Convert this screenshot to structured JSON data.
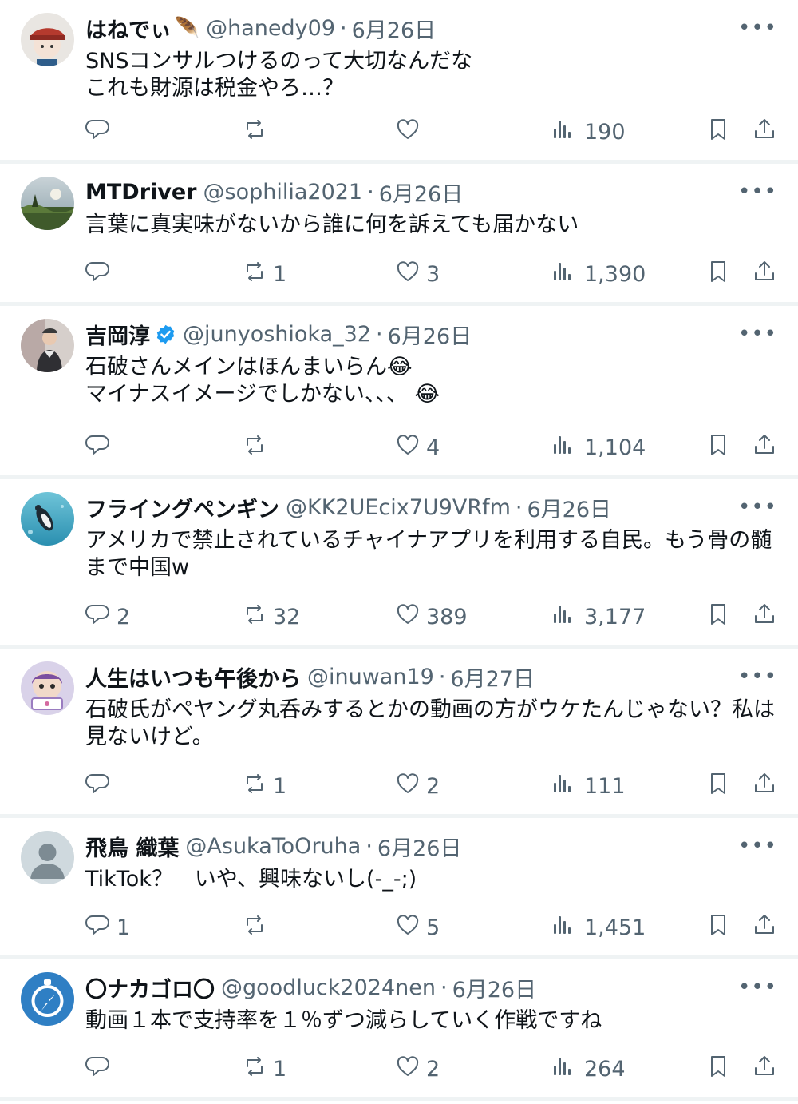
{
  "posts": [
    {
      "name": "はねでぃ",
      "name_emoji": "🪶",
      "handle": "@hanedy09",
      "date": "6月26日",
      "lines": [
        "SNSコンサルつけるのって大切なんだな",
        "これも財源は税金やろ…？"
      ],
      "replies": "",
      "reposts": "",
      "likes": "",
      "views": "190",
      "avatar_icon": "avatar-red-cap-icon"
    },
    {
      "name": "MTDriver",
      "handle": "@sophilia2021",
      "date": "6月26日",
      "lines": [
        "言葉に真実味がないから誰に何を訴えても届かない"
      ],
      "replies": "",
      "reposts": "1",
      "likes": "3",
      "views": "1,390",
      "avatar_icon": "avatar-landscape-icon"
    },
    {
      "name": "吉岡淳",
      "verified": true,
      "handle": "@junyoshioka_32",
      "date": "6月26日",
      "lines": [
        "石破さんメインはほんまいらん😂",
        "マイナスイメージでしかない、、、 😂"
      ],
      "replies": "",
      "reposts": "",
      "likes": "4",
      "views": "1,104",
      "avatar_icon": "avatar-person-photo-icon"
    },
    {
      "name": "フライングペンギン",
      "handle": "@KK2UEcix7U9VRfm",
      "date": "6月26日",
      "lines": [
        "アメリカで禁止されているチャイナアプリを利用する自民。もう骨の髄まで中国w"
      ],
      "replies": "2",
      "reposts": "32",
      "likes": "389",
      "views": "3,177",
      "avatar_icon": "avatar-penguin-icon"
    },
    {
      "name": "人生はいつも午後から",
      "handle": "@inuwan19",
      "date": "6月27日",
      "lines": [
        "石破氏がペヤング丸呑みするとかの動画の方がウケたんじゃない？私は見ないけど。"
      ],
      "replies": "",
      "reposts": "1",
      "likes": "2",
      "views": "111",
      "avatar_icon": "avatar-character-icon"
    },
    {
      "name": "飛鳥 織葉",
      "handle": "@AsukaToOruha",
      "date": "6月26日",
      "lines": [
        "TikTok？　いや、興味ないし(-_-;)"
      ],
      "replies": "1",
      "reposts": "",
      "likes": "5",
      "views": "1,451",
      "avatar_icon": "avatar-default-person-icon"
    },
    {
      "name": "〇ナカゴロ〇",
      "handle": "@goodluck2024nen",
      "date": "6月26日",
      "lines": [
        "動画１本で支持率を１％ずつ減らしていく作戦ですね"
      ],
      "replies": "",
      "reposts": "1",
      "likes": "2",
      "views": "264",
      "avatar_icon": "avatar-blue-compass-icon"
    }
  ],
  "ui": {
    "more_label": "•••",
    "dot_separator": "·",
    "colors": {
      "text": "#0f1419",
      "muted": "#536471",
      "divider": "#eff3f4",
      "verified": "#1d9bf0"
    }
  }
}
